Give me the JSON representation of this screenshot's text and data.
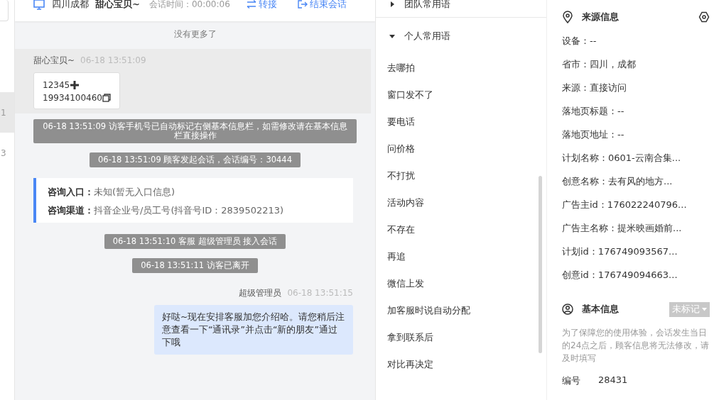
{
  "left_strip": {
    "items": [
      {
        "label": "1",
        "selected": true
      },
      {
        "label": "3",
        "selected": false
      }
    ]
  },
  "chat": {
    "header": {
      "location": "四川成都",
      "visitor": "甜心宝贝~",
      "duration_label": "会话时间：",
      "duration": "00:00:06",
      "actions": [
        "转接",
        "结束会话"
      ]
    },
    "no_more": "没有更多了",
    "messages": [
      {
        "kind": "visitor",
        "name": "甜心宝贝~",
        "time": "06-18 13:51:09",
        "lines": [
          "12345",
          "19934100460"
        ]
      },
      {
        "kind": "system",
        "text": "06-18 13:51:09 访客手机号已自动标记右侧基本信息栏，如需修改请在基本信息栏直接操作"
      },
      {
        "kind": "system",
        "text": "06-18 13:51:09 顾客发起会话，会话编号：30444"
      },
      {
        "kind": "info",
        "rows": [
          {
            "label": "咨询入口：",
            "value": "未知(暂无入口信息)"
          },
          {
            "label": "咨询渠道：",
            "value": "抖音企业号/员工号(抖音号ID：2839502213)"
          }
        ]
      },
      {
        "kind": "system",
        "text": "06-18 13:51:10 客服 超级管理员 接入会话"
      },
      {
        "kind": "system",
        "text": "06-18 13:51:11 访客已离开"
      },
      {
        "kind": "agent",
        "name": "超级管理员",
        "time": "06-18 13:51:15",
        "text": "好哒~现在安排客服加您介绍哈。请您稍后注意查看一下“通讯录”并点击“新的朋友”通过下哦"
      }
    ]
  },
  "phrases": {
    "groups": [
      {
        "title": "团队常用语",
        "expanded": false
      },
      {
        "title": "个人常用语",
        "expanded": true
      }
    ],
    "items": [
      "去哪拍",
      "窗口发不了",
      "要电话",
      "问价格",
      "不打扰",
      "活动内容",
      "不存在",
      "再追",
      "微信上发",
      "加客服时说自动分配",
      "拿到联系后",
      "对比再决定"
    ]
  },
  "source": {
    "title": "来源信息",
    "fields": [
      "设备：--",
      "省市：四川，成都",
      "来源：直接访问",
      "落地页标题：--",
      "落地页地址：--",
      "计划名称：0601-云南合集...",
      "创意名称：去有风的地方...",
      "广告主id：176022240796...",
      "广告主名称：提米映画婚前...",
      "计划id：176749093567...",
      "创意id：176749094663..."
    ]
  },
  "basic": {
    "title": "基本信息",
    "tag": "未标记",
    "notice": "为了保障您的使用体验，会话发生当日的24点之后，顾客信息将无法修改，请及时填写",
    "fields": [
      {
        "label": "编号",
        "value": "28431"
      }
    ]
  }
}
